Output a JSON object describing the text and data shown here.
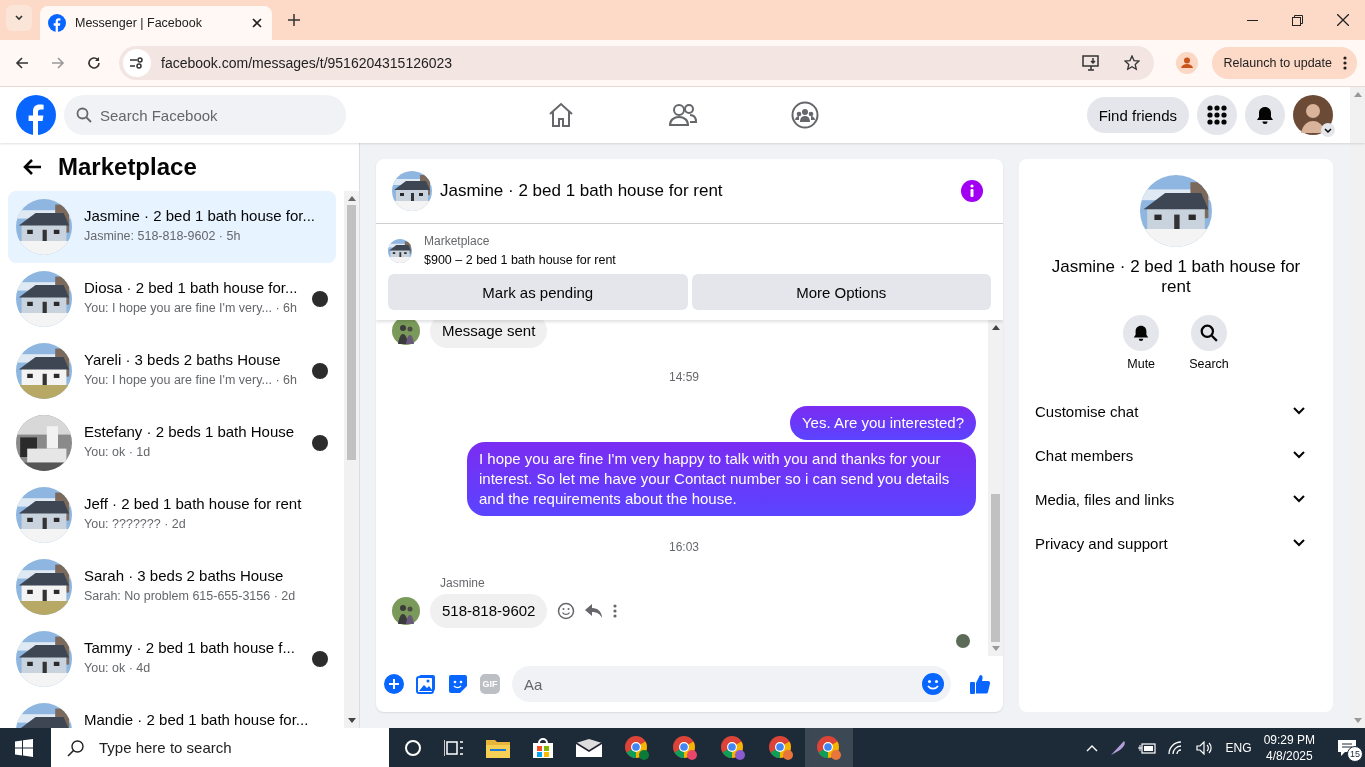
{
  "browser": {
    "tab_title": "Messenger | Facebook",
    "url": "facebook.com/messages/t/9516204315126023",
    "update_button": "Relaunch to update"
  },
  "header": {
    "search_placeholder": "Search Facebook",
    "find_friends": "Find friends"
  },
  "sidebar": {
    "title": "Marketplace",
    "conversations": [
      {
        "title": "Jasmine · 2 bed 1 bath house for...",
        "preview": "Jasmine: 518-818-9602 · 5h",
        "selected": true,
        "seen": false
      },
      {
        "title": "Diosa · 2 bed 1 bath house for...",
        "preview": "You: I hope you are fine I'm very... · 6h",
        "selected": false,
        "seen": true
      },
      {
        "title": "Yareli · 3 beds 2 baths House",
        "preview": "You: I hope you are fine I'm very... · 6h",
        "selected": false,
        "seen": true
      },
      {
        "title": "Estefany · 2 beds 1 bath House",
        "preview": "You: ok · 1d",
        "selected": false,
        "seen": true
      },
      {
        "title": "Jeff · 2 bed 1 bath house for rent",
        "preview": "You: ??????? · 2d",
        "selected": false,
        "seen": false
      },
      {
        "title": "Sarah · 3 beds 2 baths House",
        "preview": "Sarah: No problem 615-655-3156 · 2d",
        "selected": false,
        "seen": false
      },
      {
        "title": "Tammy · 2 bed 1 bath house f...",
        "preview": "You: ok · 4d",
        "selected": false,
        "seen": true
      },
      {
        "title": "Mandie · 2 bed 1 bath house for...",
        "selected": false,
        "seen": false
      }
    ]
  },
  "chat": {
    "title": "Jasmine · 2 bed 1 bath house for rent",
    "listing": {
      "label": "Marketplace",
      "text": "$900 – 2 bed 1 bath house for rent"
    },
    "buttons": [
      "Mark as pending",
      "More Options"
    ],
    "messages": [
      {
        "kind": "received",
        "text": "Message sent"
      },
      {
        "kind": "time",
        "text": "14:59"
      },
      {
        "kind": "sent",
        "text": "Yes. Are you interested?"
      },
      {
        "kind": "sent",
        "text": "I hope you are fine I'm very happy to talk with you and thanks for your interest. So let me have your Contact number so i can send you details and the requirements about the house."
      },
      {
        "kind": "time",
        "text": "16:03"
      },
      {
        "kind": "received",
        "sender": "Jasmine",
        "text": "518-818-9602",
        "actions": true
      }
    ],
    "composer": {
      "gif_label": "GIF",
      "placeholder": "Aa"
    }
  },
  "details": {
    "title": "Jasmine · 2 bed 1 bath house for rent",
    "actions": [
      {
        "kind": "bell",
        "label": "Mute"
      },
      {
        "kind": "search",
        "label": "Search"
      }
    ],
    "sections": [
      "Customise chat",
      "Chat members",
      "Media, files and links",
      "Privacy and support"
    ]
  },
  "taskbar": {
    "search_placeholder": "Type here to search",
    "language": "ENG",
    "time": "09:29 PM",
    "date": "4/8/2025",
    "notifications": "15"
  }
}
